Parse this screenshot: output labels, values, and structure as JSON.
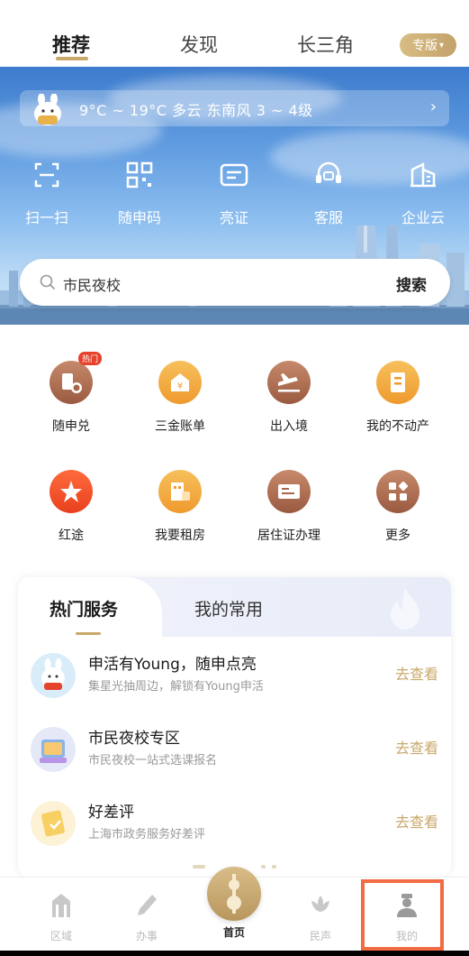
{
  "header": {
    "tabs": [
      {
        "label": "推荐",
        "active": true
      },
      {
        "label": "发现",
        "active": false
      },
      {
        "label": "长三角",
        "active": false
      }
    ],
    "edition_label": "专版",
    "accent_color": "#c9a86b"
  },
  "weather": {
    "text": "9°C ~ 19°C  多云  东南风  3 ~ 4级"
  },
  "quick_actions": [
    {
      "label": "扫一扫",
      "icon": "scan-icon"
    },
    {
      "label": "随申码",
      "icon": "qr-code-icon"
    },
    {
      "label": "亮证",
      "icon": "id-card-icon"
    },
    {
      "label": "客服",
      "icon": "customer-service-icon"
    },
    {
      "label": "企业云",
      "icon": "building-icon"
    }
  ],
  "search": {
    "placeholder": "市民夜校",
    "button_label": "搜索"
  },
  "services": [
    {
      "label": "随申兑",
      "icon": "exchange-icon",
      "badge": "热门",
      "color": "#a8654a"
    },
    {
      "label": "三金账单",
      "icon": "fund-bill-icon",
      "color": "#f0a43c"
    },
    {
      "label": "出入境",
      "icon": "airplane-icon",
      "color": "#a8654a"
    },
    {
      "label": "我的不动产",
      "icon": "property-icon",
      "color": "#f0a43c"
    },
    {
      "label": "红途",
      "icon": "red-star-icon",
      "color": "#f0512e"
    },
    {
      "label": "我要租房",
      "icon": "rent-house-icon",
      "color": "#f0a43c"
    },
    {
      "label": "居住证办理",
      "icon": "residence-permit-icon",
      "color": "#a8654a"
    },
    {
      "label": "更多",
      "icon": "more-grid-icon",
      "color": "#a8654a"
    }
  ],
  "hot_services": {
    "tabs": [
      {
        "label": "热门服务",
        "active": true
      },
      {
        "label": "我的常用",
        "active": false
      }
    ],
    "items": [
      {
        "title": "申活有Young，随申点亮",
        "subtitle": "集星光抽周边，解锁有Young申活",
        "link": "去查看"
      },
      {
        "title": "市民夜校专区",
        "subtitle": "市民夜校一站式选课报名",
        "link": "去查看"
      },
      {
        "title": "好差评",
        "subtitle": "上海市政务服务好差评",
        "link": "去查看"
      }
    ]
  },
  "bottom_nav": [
    {
      "label": "区域",
      "icon": "district-icon",
      "active": false
    },
    {
      "label": "办事",
      "icon": "pen-icon",
      "active": false
    },
    {
      "label": "首页",
      "icon": "home-tower-icon",
      "active": true
    },
    {
      "label": "民声",
      "icon": "lotus-icon",
      "active": false
    },
    {
      "label": "我的",
      "icon": "profile-icon",
      "active": false
    }
  ]
}
